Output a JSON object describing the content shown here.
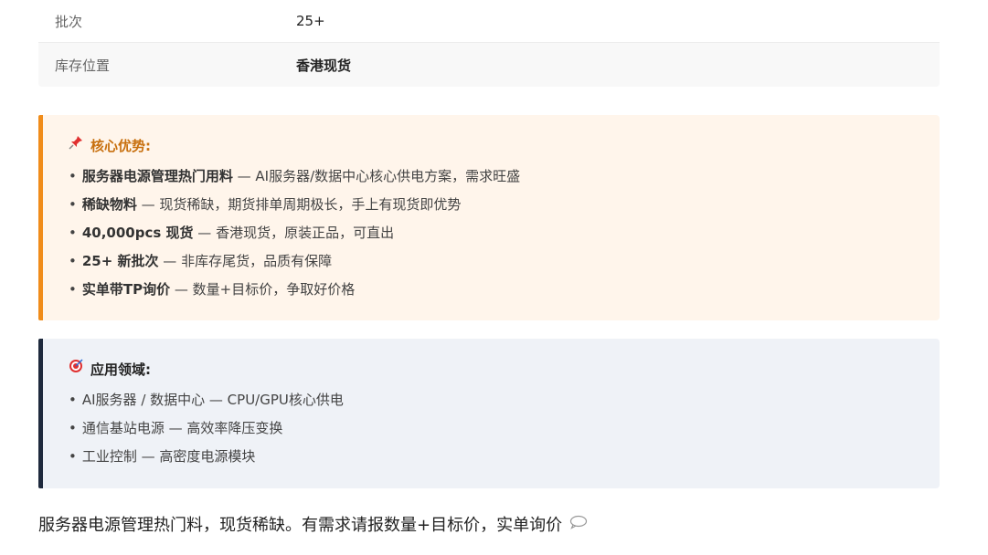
{
  "spec_table": {
    "rows": [
      {
        "key": "批次",
        "value": "25+"
      },
      {
        "key": "库存位置",
        "value": "香港现货"
      }
    ]
  },
  "advantages": {
    "icon": "pushpin-icon",
    "title": "核心优势:",
    "accent_color": "#f08c1a",
    "items": [
      {
        "bullet": "•",
        "strong": "服务器电源管理热门用料",
        "desc": " — AI服务器/数据中心核心供电方案，需求旺盛"
      },
      {
        "bullet": "•",
        "strong": "稀缺物料",
        "desc": " — 现货稀缺，期货排单周期极长，手上有现货即优势"
      },
      {
        "bullet": "•",
        "strong": "40,000pcs 现货",
        "desc": " — 香港现货，原装正品，可直出"
      },
      {
        "bullet": "•",
        "strong": "25+ 新批次",
        "desc": " — 非库存尾货，品质有保障"
      },
      {
        "bullet": "•",
        "strong": "实单带TP询价",
        "desc": " — 数量+目标价，争取好价格"
      }
    ]
  },
  "applications": {
    "icon": "target-icon",
    "title": "应用领域:",
    "accent_color": "#1f2a3d",
    "items": [
      {
        "bullet": "•",
        "text": "AI服务器 / 数据中心 — CPU/GPU核心供电"
      },
      {
        "bullet": "•",
        "text": "通信基站电源 — 高效率降压变换"
      },
      {
        "bullet": "•",
        "text": "工业控制 — 高密度电源模块"
      }
    ]
  },
  "footer": {
    "text": "服务器电源管理热门料，现货稀缺。有需求请报数量+目标价，实单询价",
    "icon": "speech-bubble-icon"
  }
}
